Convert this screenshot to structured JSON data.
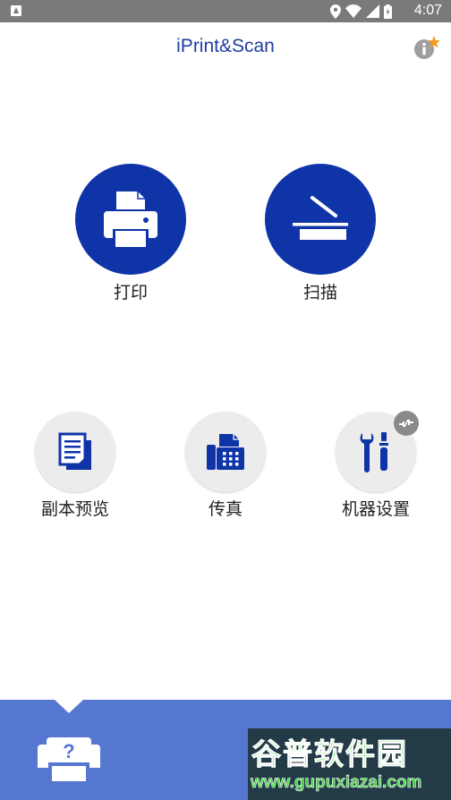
{
  "status_bar": {
    "time": "4:07"
  },
  "app": {
    "title": "iPrint&Scan"
  },
  "main_actions": {
    "print_label": "打印",
    "scan_label": "扫描"
  },
  "secondary_actions": {
    "copy_preview_label": "副本预览",
    "fax_label": "传真",
    "machine_settings_label": "机器设置"
  },
  "colors": {
    "primary": "#0f34a8",
    "title": "#1e3d9e",
    "bottom_panel": "#5577d0",
    "status_bar": "#7a7a7a",
    "badge_star": "#f39c1f"
  },
  "watermark": {
    "brand": "谷普软件园",
    "url": "www.gupuxiazai.com"
  },
  "icons": [
    "print-icon",
    "scan-icon",
    "copy-preview-icon",
    "fax-icon",
    "machine-settings-icon",
    "info-icon",
    "disconnected-icon",
    "printer-select-icon"
  ]
}
